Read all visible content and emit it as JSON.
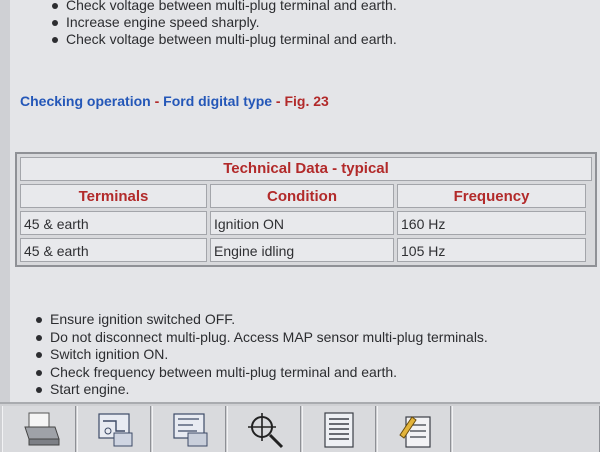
{
  "top_bullets": [
    "Check voltage between multi-plug terminal and earth.",
    "Increase engine speed sharply.",
    "Check voltage between multi-plug terminal and earth."
  ],
  "heading": {
    "part1": "Checking operation",
    "sep1": " - ",
    "part2": "Ford digital type",
    "sep2": " - ",
    "part3": "Fig. 23"
  },
  "table": {
    "title": "Technical Data - typical",
    "headers": [
      "Terminals",
      "Condition",
      "Frequency"
    ],
    "rows": [
      [
        "45 & earth",
        "Ignition ON",
        "160 Hz"
      ],
      [
        "45 & earth",
        "Engine idling",
        "105 Hz"
      ]
    ]
  },
  "bottom_bullets": [
    "Ensure ignition switched OFF.",
    "Do not disconnect multi-plug. Access MAP sensor multi-plug terminals.",
    "Switch ignition ON.",
    "Check frequency between multi-plug terminal and earth.",
    "Start engine."
  ],
  "toolbar": {
    "icons": [
      "print-icon",
      "wiring-diagram-icon",
      "component-diagram-icon",
      "locate-icon",
      "data-list-icon",
      "notes-icon"
    ]
  },
  "colors": {
    "heading_blue": "#2457b8",
    "heading_red": "#b22a2a",
    "table_header_red": "#b22a2a"
  }
}
